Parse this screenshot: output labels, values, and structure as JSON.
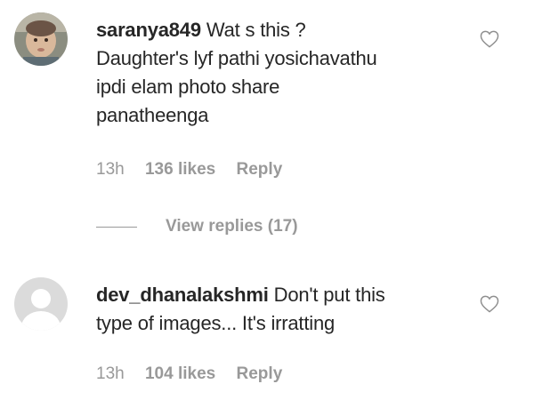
{
  "comments": [
    {
      "username": "saranya849",
      "lines": [
        "Wat s this ?",
        "Daughter's lyf pathi yosichavathu",
        "ipdi elam photo share",
        "panatheenga"
      ],
      "time": "13h",
      "likes": "136 likes",
      "reply": "Reply",
      "avatar": "baby-photo-avatar"
    },
    {
      "username": "dev_dhanalakshmi",
      "lines": [
        "Don't put this",
        "type of images... It's irratting"
      ],
      "time": "13h",
      "likes": "104 likes",
      "reply": "Reply",
      "avatar": "default-avatar"
    }
  ],
  "replies": {
    "label": "View replies (17)"
  },
  "icons": {
    "like": "heart-icon"
  },
  "colors": {
    "text": "#262626",
    "muted": "#999999",
    "background": "#ffffff"
  }
}
